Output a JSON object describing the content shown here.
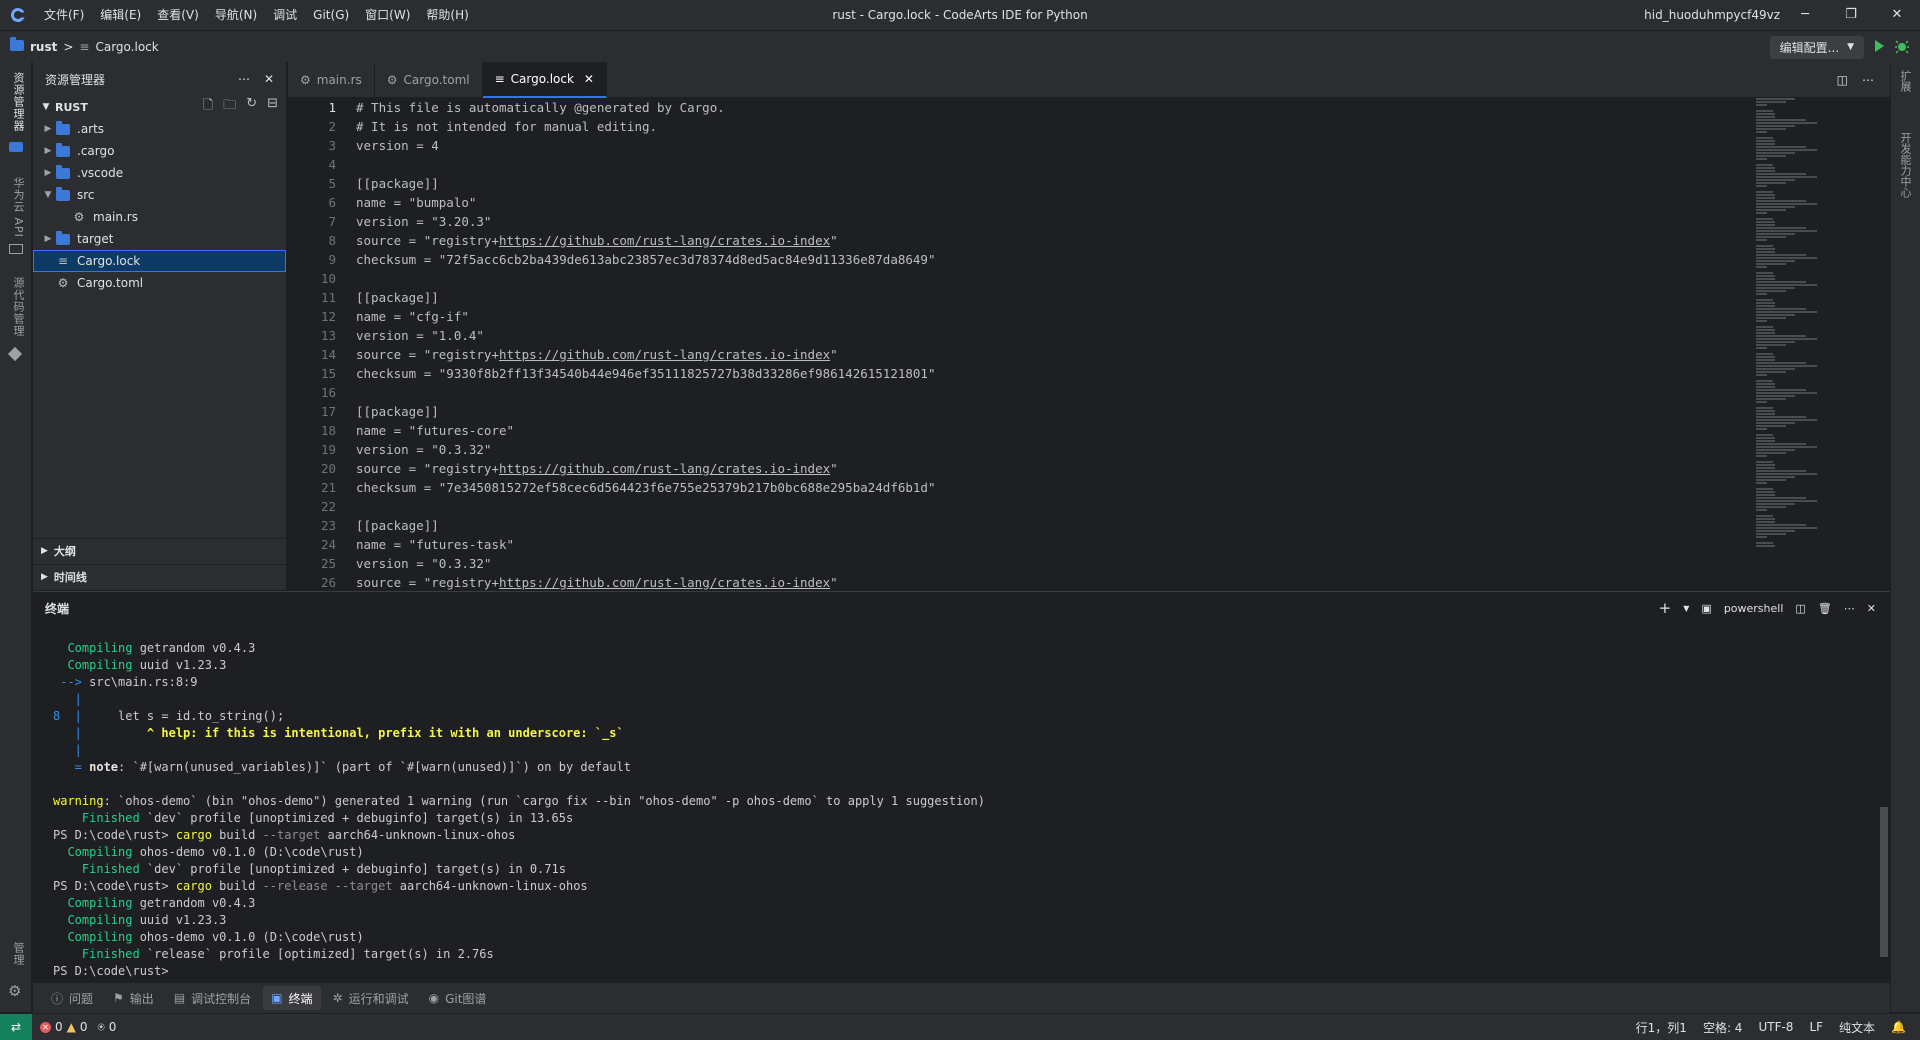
{
  "titlebar": {
    "menu": [
      "文件(F)",
      "编辑(E)",
      "查看(V)",
      "导航(N)",
      "调试",
      "Git(G)",
      "窗口(W)",
      "帮助(H)"
    ],
    "window_title": "rust - Cargo.lock - CodeArts IDE for Python",
    "user": "hid_huoduhmpycf49vz"
  },
  "breadcrumb": {
    "project": "rust",
    "separator": ">",
    "file": "Cargo.lock",
    "config_label": "编辑配置..."
  },
  "activity": {
    "explorer": "资源管理器",
    "huawei_api": "华为云 API",
    "source_control": "源代码管理",
    "manage": "管理"
  },
  "rightbar": {
    "extensions": "扩展",
    "dev_center": "开发能力中心"
  },
  "sidebar": {
    "title": "资源管理器",
    "root": "RUST",
    "items": [
      {
        "label": ".arts",
        "kind": "folder",
        "depth": 0,
        "twisty": "▶"
      },
      {
        "label": ".cargo",
        "kind": "folder",
        "depth": 0,
        "twisty": "▶"
      },
      {
        "label": ".vscode",
        "kind": "folder",
        "depth": 0,
        "twisty": "▶"
      },
      {
        "label": "src",
        "kind": "folder",
        "depth": 0,
        "twisty": "▼"
      },
      {
        "label": "main.rs",
        "kind": "rust-file",
        "depth": 1,
        "twisty": ""
      },
      {
        "label": "target",
        "kind": "folder",
        "depth": 0,
        "twisty": "▶"
      },
      {
        "label": "Cargo.lock",
        "kind": "lock-file",
        "depth": 0,
        "twisty": ""
      },
      {
        "label": "Cargo.toml",
        "kind": "toml-file",
        "depth": 0,
        "twisty": ""
      }
    ],
    "outline": "大纲",
    "timeline": "时间线"
  },
  "tabs": [
    {
      "label": "main.rs",
      "icon": "rust-icon",
      "active": false
    },
    {
      "label": "Cargo.toml",
      "icon": "gear-icon",
      "active": false
    },
    {
      "label": "Cargo.lock",
      "icon": "lines-icon",
      "active": true,
      "close": "✕"
    }
  ],
  "editor": {
    "current_line": 1,
    "lines": [
      "# This file is automatically @generated by Cargo.",
      "# It is not intended for manual editing.",
      "version = 4",
      "",
      "[[package]]",
      "name = \"bumpalo\"",
      "version = \"3.20.3\"",
      "source = \"registry+https://github.com/rust-lang/crates.io-index\"",
      "checksum = \"72f5acc6cb2ba439de613abc23857ec3d78374d8ed5ac84e9d11336e87da8649\"",
      "",
      "[[package]]",
      "name = \"cfg-if\"",
      "version = \"1.0.4\"",
      "source = \"registry+https://github.com/rust-lang/crates.io-index\"",
      "checksum = \"9330f8b2ff13f34540b44e946ef35111825727b38d33286ef986142615121801\"",
      "",
      "[[package]]",
      "name = \"futures-core\"",
      "version = \"0.3.32\"",
      "source = \"registry+https://github.com/rust-lang/crates.io-index\"",
      "checksum = \"7e3450815272ef58cec6d564423f6e755e25379b217b0bc688e295ba24df6b1d\"",
      "",
      "[[package]]",
      "name = \"futures-task\"",
      "version = \"0.3.32\"",
      "source = \"registry+https://github.com/rust-lang/crates.io-index\""
    ]
  },
  "panel": {
    "title": "终端",
    "shell": "powershell",
    "lines": [
      [
        {
          "t": "  Compiling",
          "c": "g"
        },
        {
          "t": " getrandom v0.4.3"
        }
      ],
      [
        {
          "t": "  Compiling",
          "c": "g"
        },
        {
          "t": " uuid v1.23.3"
        }
      ],
      [
        {
          "t": " -->",
          "c": "b"
        },
        {
          "t": " src\\main.rs:8:9"
        }
      ],
      [
        {
          "t": "   |",
          "c": "b"
        }
      ],
      [
        {
          "t": "8  |",
          "c": "b"
        },
        {
          "t": "     let s = id.to_string();"
        }
      ],
      [
        {
          "t": "   |",
          "c": "b"
        },
        {
          "t": "         ^ help: if this is intentional, prefix it with an underscore: `_s`",
          "c": "y"
        }
      ],
      [
        {
          "t": "   |",
          "c": "b"
        }
      ],
      [
        {
          "t": "   = ",
          "c": "b"
        },
        {
          "t": "note",
          "c": "w"
        },
        {
          "t": ": `#[warn(unused_variables)]` (part of `#[warn(unused)]`) on by default"
        }
      ],
      [
        {
          "t": ""
        }
      ],
      [
        {
          "t": "warning",
          "c": "yb"
        },
        {
          "t": ": `ohos-demo` (bin \"ohos-demo\") generated 1 warning (run `cargo fix --bin \"ohos-demo\" -p ohos-demo` to apply 1 suggestion)"
        }
      ],
      [
        {
          "t": "    Finished",
          "c": "g"
        },
        {
          "t": " `dev` profile [unoptimized + debuginfo] target(s) in 13.65s"
        }
      ],
      [
        {
          "t": "PS D:\\code\\rust> "
        },
        {
          "t": "cargo",
          "c": "yb"
        },
        {
          "t": " build "
        },
        {
          "t": "--target",
          "c": "gr"
        },
        {
          "t": " aarch64-unknown-linux-ohos"
        }
      ],
      [
        {
          "t": "  Compiling",
          "c": "g"
        },
        {
          "t": " ohos-demo v0.1.0 (D:\\code\\rust)"
        }
      ],
      [
        {
          "t": "    Finished",
          "c": "g"
        },
        {
          "t": " `dev` profile [unoptimized + debuginfo] target(s) in 0.71s"
        }
      ],
      [
        {
          "t": "PS D:\\code\\rust> "
        },
        {
          "t": "cargo",
          "c": "yb"
        },
        {
          "t": " build "
        },
        {
          "t": "--release --target",
          "c": "gr"
        },
        {
          "t": " aarch64-unknown-linux-ohos"
        }
      ],
      [
        {
          "t": "  Compiling",
          "c": "g"
        },
        {
          "t": " getrandom v0.4.3"
        }
      ],
      [
        {
          "t": "  Compiling",
          "c": "g"
        },
        {
          "t": " uuid v1.23.3"
        }
      ],
      [
        {
          "t": "  Compiling",
          "c": "g"
        },
        {
          "t": " ohos-demo v0.1.0 (D:\\code\\rust)"
        }
      ],
      [
        {
          "t": "    Finished",
          "c": "g"
        },
        {
          "t": " `release` profile [optimized] target(s) in 2.76s"
        }
      ],
      [
        {
          "t": "PS D:\\code\\rust> "
        }
      ]
    ]
  },
  "bottom_tabs": [
    {
      "label": "问题",
      "icon": "info-icon",
      "active": false
    },
    {
      "label": "输出",
      "icon": "flag-icon",
      "active": false
    },
    {
      "label": "调试控制台",
      "icon": "console-icon",
      "active": false
    },
    {
      "label": "终端",
      "icon": "terminal-icon",
      "active": true
    },
    {
      "label": "运行和调试",
      "icon": "bug-icon",
      "active": false
    },
    {
      "label": "Git图谱",
      "icon": "git-icon",
      "active": false
    }
  ],
  "statusbar": {
    "errors": "0",
    "warnings": "0",
    "ports": "0",
    "position": "行1，列1",
    "indent": "空格: 4",
    "encoding": "UTF-8",
    "eol": "LF",
    "language": "纯文本"
  },
  "colors": {
    "accent": "#3574f0",
    "terminal_green": "#23d18b",
    "terminal_yellow": "#f5f543",
    "terminal_blue": "#3b8eea",
    "status_remote": "#16825d"
  }
}
